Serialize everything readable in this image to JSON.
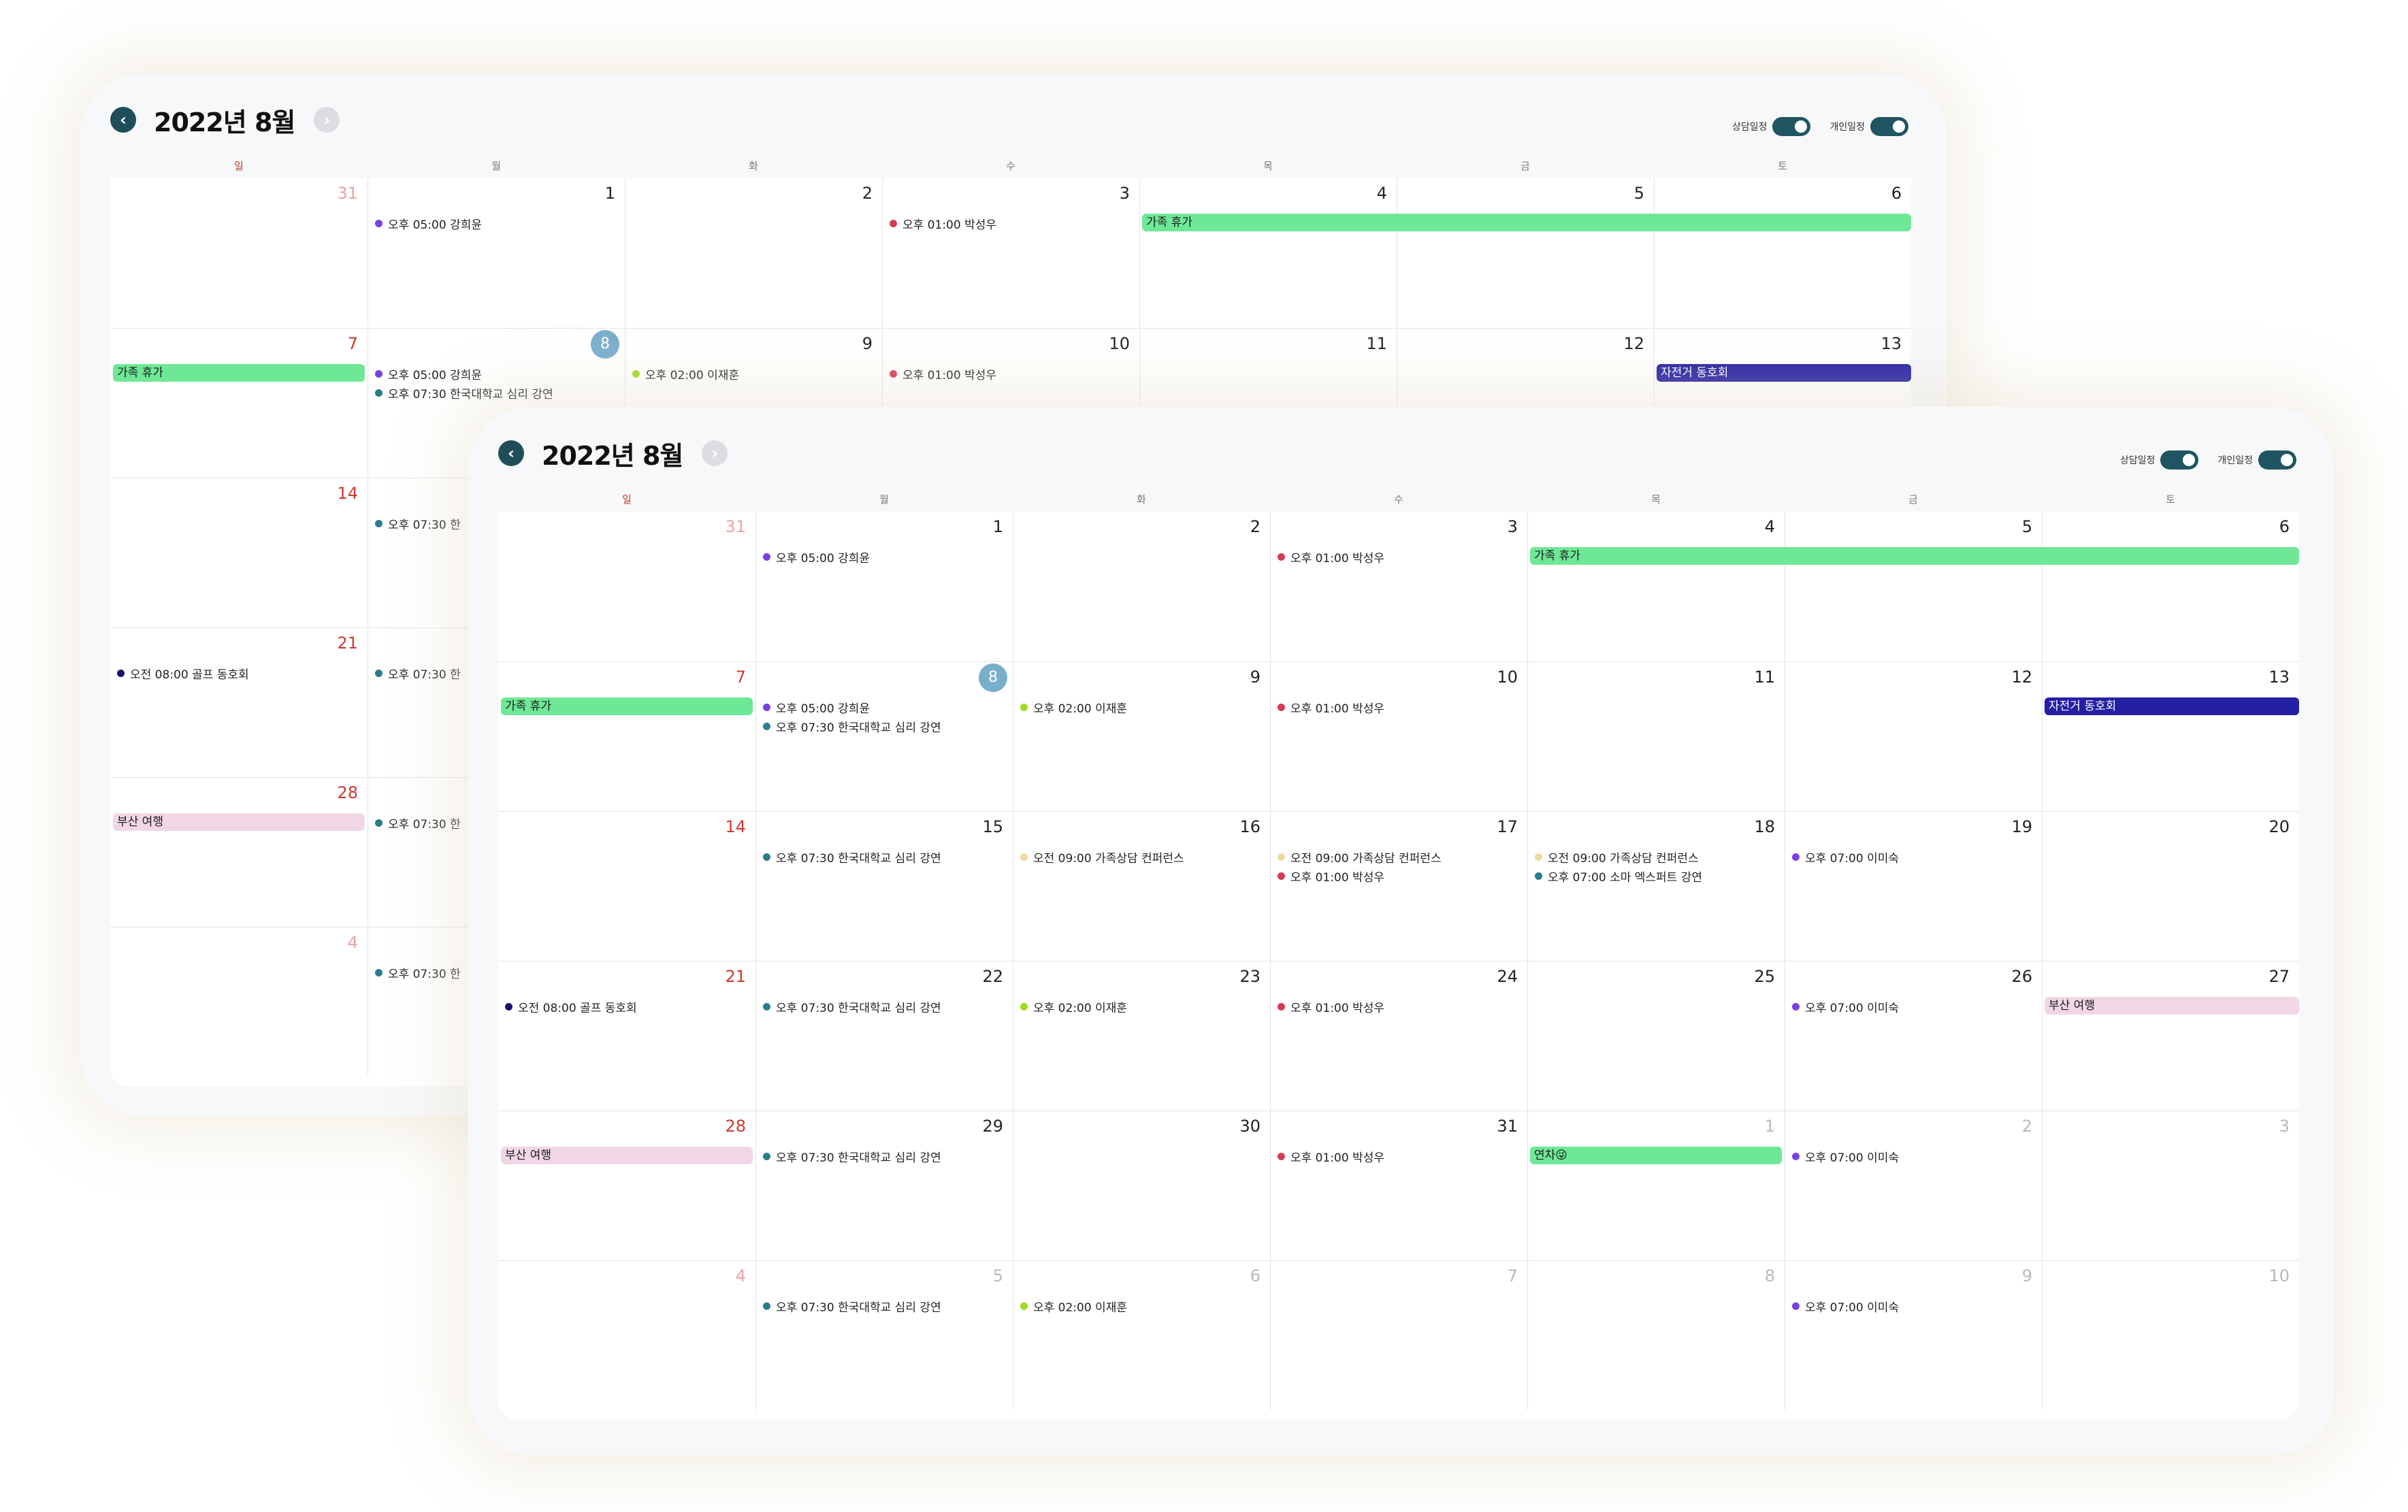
{
  "title": "2022년 8월",
  "nav": {
    "prev_icon": "chevron-left-icon",
    "next_icon": "chevron-right-icon",
    "prev_glyph": "‹",
    "next_glyph": "›"
  },
  "toggles": [
    {
      "label": "상담일정",
      "on": true
    },
    {
      "label": "개인일정",
      "on": true
    }
  ],
  "weekdays": [
    "일",
    "월",
    "화",
    "수",
    "목",
    "금",
    "토"
  ],
  "colors": {
    "accent": "#1f5560",
    "sunday": "#d0382e",
    "today": "#7aaecd",
    "purple": "#7b3fe4",
    "red": "#d63a55",
    "teal": "#2a7d8c",
    "lime": "#9fdb1d",
    "beige": "#efd9a0",
    "navy": "#141170",
    "bar_green": "#6ee897",
    "bar_navy": "#241fa3",
    "bar_pink": "#f1d7e6"
  },
  "events": {
    "kang": "오후 05:00 강희윤",
    "park": "오후 01:00 박성우",
    "lee": "오후 02:00 이재훈",
    "lecture": "오후 07:30 한국대학교 심리 강연",
    "lecture_short": "오후 07:30 한",
    "conference": "오전 09:00 가족상담 컨퍼런스",
    "soma": "오후 07:00 소마 엑스퍼트 강연",
    "leemisuk": "오후 07:00 이미숙",
    "golf": "오전 08:00 골프 동호회"
  },
  "bars": {
    "family": "가족 휴가",
    "bike": "자전거 동호회",
    "busan": "부산 여행",
    "leave": "연차😜"
  },
  "weeks": [
    {
      "days": [
        {
          "num": "31",
          "other": true,
          "events": []
        },
        {
          "num": "1",
          "events": [
            {
              "color": "purple",
              "key": "kang"
            }
          ]
        },
        {
          "num": "2",
          "events": []
        },
        {
          "num": "3",
          "events": [
            {
              "color": "red",
              "key": "park"
            }
          ]
        },
        {
          "num": "4",
          "events": []
        },
        {
          "num": "5",
          "events": []
        },
        {
          "num": "6",
          "events": []
        }
      ],
      "bars": [
        {
          "key": "family",
          "style": "green",
          "start": 4,
          "span": 3
        }
      ]
    },
    {
      "days": [
        {
          "num": "7",
          "events": []
        },
        {
          "num": "8",
          "today": true,
          "events": [
            {
              "color": "purple",
              "key": "kang"
            },
            {
              "color": "teal",
              "key": "lecture"
            }
          ]
        },
        {
          "num": "9",
          "events": [
            {
              "color": "lime",
              "key": "lee"
            }
          ]
        },
        {
          "num": "10",
          "events": [
            {
              "color": "red",
              "key": "park"
            }
          ]
        },
        {
          "num": "11",
          "events": []
        },
        {
          "num": "12",
          "events": []
        },
        {
          "num": "13",
          "events": []
        }
      ],
      "bars": [
        {
          "key": "family",
          "style": "green",
          "start": 0,
          "span": 1
        },
        {
          "key": "bike",
          "style": "navy",
          "start": 6,
          "span": 1
        }
      ]
    },
    {
      "days": [
        {
          "num": "14",
          "events": []
        },
        {
          "num": "15",
          "events": [
            {
              "color": "teal",
              "key": "lecture"
            }
          ]
        },
        {
          "num": "16",
          "events": [
            {
              "color": "beige",
              "key": "conference"
            }
          ]
        },
        {
          "num": "17",
          "events": [
            {
              "color": "beige",
              "key": "conference"
            },
            {
              "color": "red",
              "key": "park"
            }
          ]
        },
        {
          "num": "18",
          "events": [
            {
              "color": "beige",
              "key": "conference"
            },
            {
              "color": "teal",
              "key": "soma"
            }
          ]
        },
        {
          "num": "19",
          "events": [
            {
              "color": "purple",
              "key": "leemisuk"
            }
          ]
        },
        {
          "num": "20",
          "events": []
        }
      ],
      "bars": []
    },
    {
      "days": [
        {
          "num": "21",
          "events": [
            {
              "color": "navy",
              "key": "golf"
            }
          ]
        },
        {
          "num": "22",
          "events": [
            {
              "color": "teal",
              "key": "lecture"
            }
          ]
        },
        {
          "num": "23",
          "events": [
            {
              "color": "lime",
              "key": "lee"
            }
          ]
        },
        {
          "num": "24",
          "events": [
            {
              "color": "red",
              "key": "park"
            }
          ]
        },
        {
          "num": "25",
          "events": []
        },
        {
          "num": "26",
          "events": [
            {
              "color": "purple",
              "key": "leemisuk"
            }
          ]
        },
        {
          "num": "27",
          "events": []
        }
      ],
      "bars": [
        {
          "key": "busan",
          "style": "pink",
          "start": 6,
          "span": 1
        }
      ]
    },
    {
      "days": [
        {
          "num": "28",
          "events": []
        },
        {
          "num": "29",
          "events": [
            {
              "color": "teal",
              "key": "lecture"
            }
          ]
        },
        {
          "num": "30",
          "events": []
        },
        {
          "num": "31",
          "events": [
            {
              "color": "red",
              "key": "park"
            }
          ]
        },
        {
          "num": "1",
          "other": true,
          "events": []
        },
        {
          "num": "2",
          "other": true,
          "events": [
            {
              "color": "purple",
              "key": "leemisuk"
            }
          ]
        },
        {
          "num": "3",
          "other": true,
          "events": []
        }
      ],
      "bars": [
        {
          "key": "busan",
          "style": "pink",
          "start": 0,
          "span": 1
        },
        {
          "key": "leave",
          "style": "green",
          "start": 4,
          "span": 1
        }
      ]
    },
    {
      "days": [
        {
          "num": "4",
          "other": true,
          "events": []
        },
        {
          "num": "5",
          "other": true,
          "events": [
            {
              "color": "teal",
              "key": "lecture"
            }
          ]
        },
        {
          "num": "6",
          "other": true,
          "events": [
            {
              "color": "lime",
              "key": "lee"
            }
          ]
        },
        {
          "num": "7",
          "other": true,
          "events": []
        },
        {
          "num": "8",
          "other": true,
          "events": []
        },
        {
          "num": "9",
          "other": true,
          "events": [
            {
              "color": "purple",
              "key": "leemisuk"
            }
          ]
        },
        {
          "num": "10",
          "other": true,
          "events": []
        }
      ],
      "bars": []
    }
  ],
  "back_weeks": [
    {
      "days": [
        {
          "num": "31",
          "other": true,
          "events": []
        },
        {
          "num": "1",
          "events": [
            {
              "color": "purple",
              "key": "kang"
            }
          ]
        },
        {
          "num": "2",
          "events": []
        },
        {
          "num": "3",
          "events": [
            {
              "color": "red",
              "key": "park"
            }
          ]
        },
        {
          "num": "4",
          "events": []
        },
        {
          "num": "5",
          "events": []
        },
        {
          "num": "6",
          "events": []
        }
      ],
      "bars": [
        {
          "key": "family",
          "style": "green",
          "start": 4,
          "span": 3
        }
      ]
    },
    {
      "days": [
        {
          "num": "7",
          "events": []
        },
        {
          "num": "8",
          "today": true,
          "events": [
            {
              "color": "purple",
              "key": "kang"
            },
            {
              "color": "teal",
              "key": "lecture"
            }
          ]
        },
        {
          "num": "9",
          "events": [
            {
              "color": "lime",
              "key": "lee"
            }
          ]
        },
        {
          "num": "10",
          "events": [
            {
              "color": "red",
              "key": "park"
            }
          ]
        },
        {
          "num": "11",
          "events": []
        },
        {
          "num": "12",
          "events": []
        },
        {
          "num": "13",
          "events": []
        }
      ],
      "bars": [
        {
          "key": "family",
          "style": "green",
          "start": 0,
          "span": 1
        },
        {
          "key": "bike",
          "style": "navy",
          "start": 6,
          "span": 1
        }
      ]
    },
    {
      "days": [
        {
          "num": "14",
          "events": []
        },
        {
          "num": "",
          "events": [
            {
              "color": "teal",
              "key": "lecture_short"
            }
          ]
        },
        {
          "num": "",
          "events": []
        },
        {
          "num": "",
          "events": []
        },
        {
          "num": "",
          "events": []
        },
        {
          "num": "",
          "events": []
        },
        {
          "num": "",
          "events": []
        }
      ],
      "bars": []
    },
    {
      "days": [
        {
          "num": "21",
          "events": [
            {
              "color": "navy",
              "key": "golf"
            }
          ]
        },
        {
          "num": "",
          "events": [
            {
              "color": "teal",
              "key": "lecture_short"
            }
          ]
        },
        {
          "num": "",
          "events": []
        },
        {
          "num": "",
          "events": []
        },
        {
          "num": "",
          "events": []
        },
        {
          "num": "",
          "events": []
        },
        {
          "num": "",
          "events": []
        }
      ],
      "bars": []
    },
    {
      "days": [
        {
          "num": "28",
          "events": []
        },
        {
          "num": "",
          "events": [
            {
              "color": "teal",
              "key": "lecture_short"
            }
          ]
        },
        {
          "num": "",
          "events": []
        },
        {
          "num": "",
          "events": []
        },
        {
          "num": "",
          "events": []
        },
        {
          "num": "",
          "events": []
        },
        {
          "num": "",
          "events": []
        }
      ],
      "bars": [
        {
          "key": "busan",
          "style": "pink",
          "start": 0,
          "span": 1
        }
      ]
    },
    {
      "days": [
        {
          "num": "4",
          "other": true,
          "events": []
        },
        {
          "num": "",
          "events": [
            {
              "color": "teal",
              "key": "lecture_short"
            }
          ]
        },
        {
          "num": "",
          "events": []
        },
        {
          "num": "",
          "events": []
        },
        {
          "num": "",
          "events": []
        },
        {
          "num": "",
          "events": []
        },
        {
          "num": "",
          "events": []
        }
      ],
      "bars": []
    }
  ]
}
